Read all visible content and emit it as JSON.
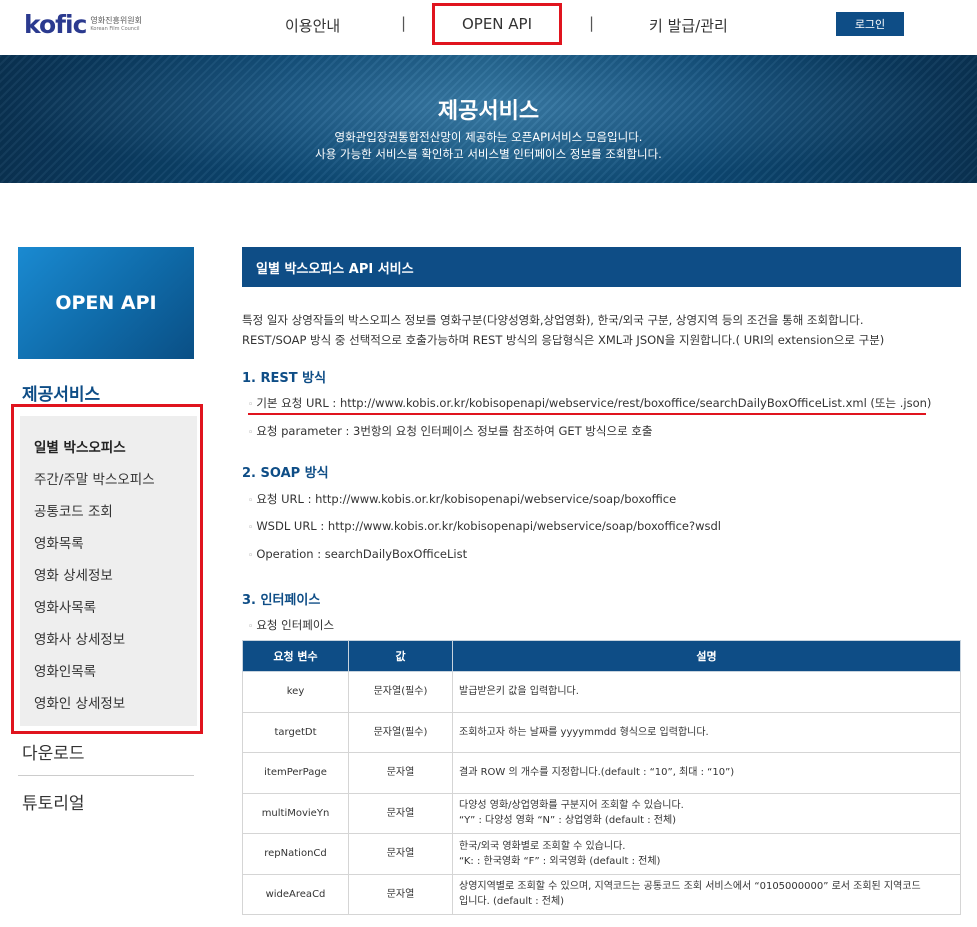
{
  "header": {
    "logo_text_main": "kofic",
    "logo_text_ko": "영화진흥위원회",
    "logo_text_en": "Korean Film Council",
    "nav": [
      {
        "label": "이용안내"
      },
      {
        "label": "OPEN API"
      },
      {
        "label": "키 발급/관리"
      }
    ],
    "separator": "|",
    "login_label": "로그인"
  },
  "banner": {
    "title": "제공서비스",
    "desc_line1": "영화관입장권통합전산망이 제공하는 오픈API서비스 모음입니다.",
    "desc_line2": "사용 가능한 서비스를 확인하고 서비스별 인터페이스 정보를 조회합니다."
  },
  "sidebar": {
    "box_title": "OPEN API",
    "heading": "제공서비스",
    "items": [
      {
        "label": "일별 박스오피스"
      },
      {
        "label": "주간/주말 박스오피스"
      },
      {
        "label": "공통코드 조회"
      },
      {
        "label": "영화목록"
      },
      {
        "label": "영화 상세정보"
      },
      {
        "label": "영화사목록"
      },
      {
        "label": "영화사 상세정보"
      },
      {
        "label": "영화인목록"
      },
      {
        "label": "영화인 상세정보"
      }
    ],
    "download_label": "다운로드",
    "tutorial_label": "튜토리얼"
  },
  "main": {
    "section_title": "일별 박스오피스 API 서비스",
    "intro_line1": "특정 일자 상영작들의 박스오피스 정보를 영화구분(다양성영화,상업영화), 한국/외국 구분, 상영지역 등의 조건을 통해 조회합니다.",
    "intro_line2": "REST/SOAP 방식 중 선택적으로 호출가능하며 REST 방식의 응답형식은 XML과 JSON을 지원합니다.( URI의 extension으로 구분)",
    "rest_heading": "1. REST 방식",
    "rest_url": "기본 요청 URL : http://www.kobis.or.kr/kobisopenapi/webservice/rest/boxoffice/searchDailyBoxOfficeList.xml (또는 .json)",
    "rest_param": "요청 parameter : 3번항의 요청 인터페이스 정보를 참조하여 GET 방식으로 호출",
    "soap_heading": "2. SOAP 방식",
    "soap_url": "요청 URL : http://www.kobis.or.kr/kobisopenapi/webservice/soap/boxoffice",
    "soap_wsdl": "WSDL URL : http://www.kobis.or.kr/kobisopenapi/webservice/soap/boxoffice?wsdl",
    "soap_operation": "Operation : searchDailyBoxOfficeList",
    "interface_heading": "3. 인터페이스",
    "interface_sub": "요청 인터페이스",
    "bullet": "◦",
    "table": {
      "headers": [
        "요청 변수",
        "값",
        "설명"
      ],
      "rows": [
        {
          "name": "key",
          "value": "문자열(필수)",
          "desc1": "발급받은키 값을 입력합니다.",
          "desc2": ""
        },
        {
          "name": "targetDt",
          "value": "문자열(필수)",
          "desc1": "조회하고자 하는 날짜를 yyyymmdd 형식으로 입력합니다.",
          "desc2": ""
        },
        {
          "name": "itemPerPage",
          "value": "문자열",
          "desc1": "결과 ROW 의 개수를 지정합니다.(default : “10”, 최대 : “10”)",
          "desc2": ""
        },
        {
          "name": "multiMovieYn",
          "value": "문자열",
          "desc1": "다양성 영화/상업영화를 구분지어 조회할 수 있습니다.",
          "desc2": "“Y” : 다양성 영화 “N” : 상업영화 (default : 전체)"
        },
        {
          "name": "repNationCd",
          "value": "문자열",
          "desc1": "한국/외국 영화별로 조회할 수 있습니다.",
          "desc2": "“K: : 한국영화 “F” : 외국영화 (default : 전체)"
        },
        {
          "name": "wideAreaCd",
          "value": "문자열",
          "desc1": "상영지역별로 조회할 수 있으며, 지역코드는 공통코드 조회 서비스에서 “0105000000” 로서 조회된 지역코드",
          "desc2": "입니다. (default : 전체)"
        }
      ]
    }
  }
}
